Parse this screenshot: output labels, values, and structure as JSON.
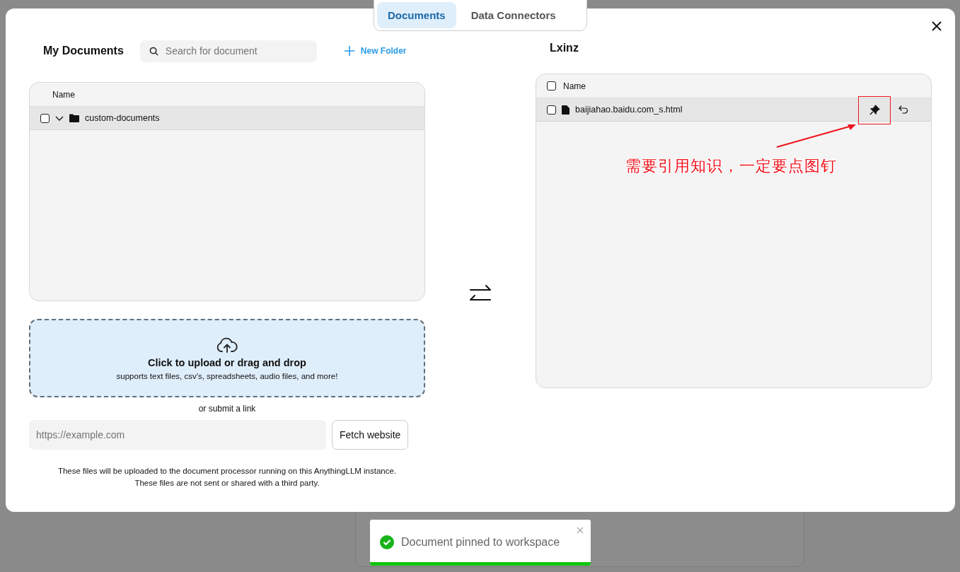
{
  "tabs": [
    {
      "label": "Documents",
      "selected": true
    },
    {
      "label": "Data Connectors",
      "selected": false
    }
  ],
  "my_documents": {
    "title": "My Documents",
    "search": {
      "placeholder": "Search for document"
    },
    "new_folder": "New Folder",
    "table": {
      "columns": [
        "Name"
      ],
      "rows": [
        {
          "name": "custom-documents",
          "kind": "folder",
          "checked": false,
          "expanded": true
        }
      ]
    },
    "upload": {
      "title": "Click to upload or drag and drop",
      "subtitle": "supports text files, csv's, spreadsheets, audio files, and more!"
    },
    "link_label": "or submit a link",
    "link_field": {
      "placeholder": "https://example.com"
    },
    "fetch_button": "Fetch website",
    "notice": [
      "These files will be uploaded to the document processor running on this AnythingLLM instance.",
      "These files are not sent or shared with a third party."
    ]
  },
  "workspace": {
    "title": "Lxinz",
    "table": {
      "columns": [
        "Name"
      ],
      "header_checked": false,
      "rows": [
        {
          "name": "baijiahao.baidu.com_s.html",
          "kind": "file",
          "checked": false,
          "pinned": true
        }
      ]
    }
  },
  "annotation": {
    "text": "需要引用知识，一定要点图钉"
  },
  "toast": {
    "message": "Document pinned to workspace",
    "level": 1
  }
}
